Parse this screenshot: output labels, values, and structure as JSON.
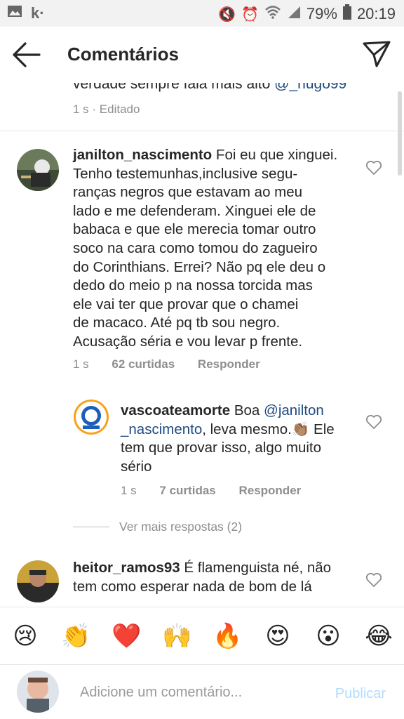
{
  "status_bar": {
    "battery": "79%",
    "time": "20:19"
  },
  "header": {
    "title": "Comentários"
  },
  "previous_comment": {
    "text": "verdade sempre fala mais alto",
    "mention": "@_hugo99",
    "time": "1 s",
    "edited": "· Editado"
  },
  "comments": [
    {
      "username": "janilton_nascimento",
      "lines": [
        "Foi eu que xinguei.",
        "Tenho testemunhas,inclusive segu-",
        "ranças negros que estavam ao meu",
        "lado e me defenderam. Xinguei ele de",
        "babaca e que ele merecia tomar outro",
        "soco na cara como tomou do zagueiro",
        "do Corinthians. Errei? Não pq ele deu o",
        "dedo do meio p na nossa torcida mas",
        "ele vai ter que provar que o chamei",
        "de macaco. Até pq tb sou negro.",
        "Acusação séria e vou levar p frente."
      ],
      "time": "1 s",
      "likes": "62 curtidas",
      "reply": "Responder"
    },
    {
      "username": "vascoateamorte",
      "text_start": "Boa",
      "mention_part1": "@janilton",
      "mention_part2": "_nascimento",
      "line2_rest": ", leva mesmo.👏🏽 Ele",
      "line3": "tem que provar isso, algo muito",
      "line4": "sério",
      "time": "1 s",
      "likes": "7 curtidas",
      "reply": "Responder"
    },
    {
      "username": "heitor_ramos93",
      "line1": "É flamenguista né, não",
      "line2": "tem como esperar nada de bom de lá"
    }
  ],
  "view_more": "Ver mais respostas (2)",
  "emojis": [
    "😢",
    "👏",
    "❤️",
    "🙌",
    "🔥",
    "😍",
    "😮",
    "😂"
  ],
  "input": {
    "placeholder": "Adicione um comentário...",
    "publish": "Publicar"
  }
}
